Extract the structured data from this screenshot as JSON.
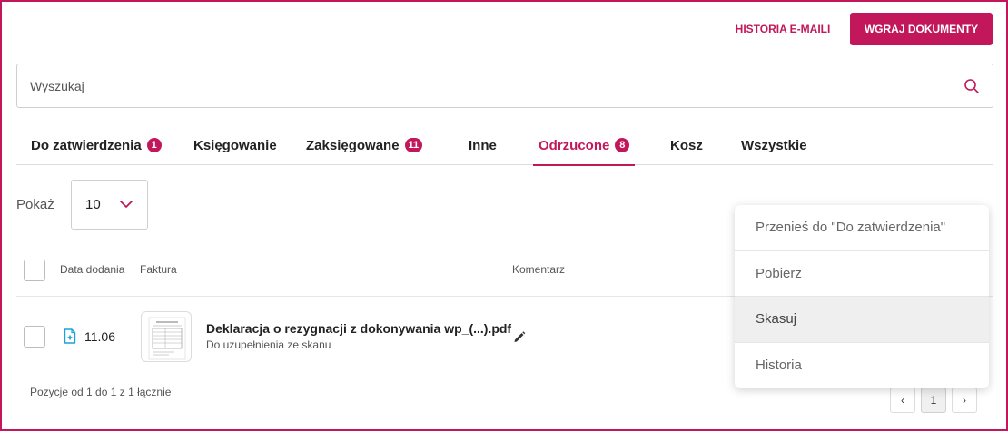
{
  "colors": {
    "accent": "#c2185b",
    "border": "#cfcfcf"
  },
  "header": {
    "email_history_label": "HISTORIA E-MAILI",
    "upload_label": "WGRAJ DOKUMENTY"
  },
  "search": {
    "placeholder": "Wyszukaj",
    "icon": "search-icon"
  },
  "tabs": [
    {
      "label": "Do zatwierdzenia",
      "badge": "1"
    },
    {
      "label": "Księgowanie"
    },
    {
      "label": "Zaksięgowane",
      "badge": "11"
    },
    {
      "label": "Inne"
    },
    {
      "label": "Odrzucone",
      "badge": "8",
      "active": true
    },
    {
      "label": "Kosz"
    },
    {
      "label": "Wszystkie"
    }
  ],
  "page_size": {
    "label": "Pokaż",
    "value": "10"
  },
  "table": {
    "columns": [
      "Data dodania",
      "Faktura",
      "Komentarz"
    ],
    "rows": [
      {
        "date": "11.06",
        "file_name": "Deklaracja o rezygnacji z dokonywania wp_(...).pdf",
        "subtitle": "Do uzupełnienia ze skanu"
      }
    ]
  },
  "footer": {
    "summary": "Pozycje od 1 do 1 z 1 łącznie"
  },
  "pagination": {
    "current": "1",
    "prev": "‹",
    "next": "›"
  },
  "context_menu": {
    "items": [
      {
        "label": "Przenieś do \"Do zatwierdzenia\""
      },
      {
        "label": "Pobierz"
      },
      {
        "label": "Skasuj",
        "hovered": true
      },
      {
        "label": "Historia"
      }
    ]
  }
}
